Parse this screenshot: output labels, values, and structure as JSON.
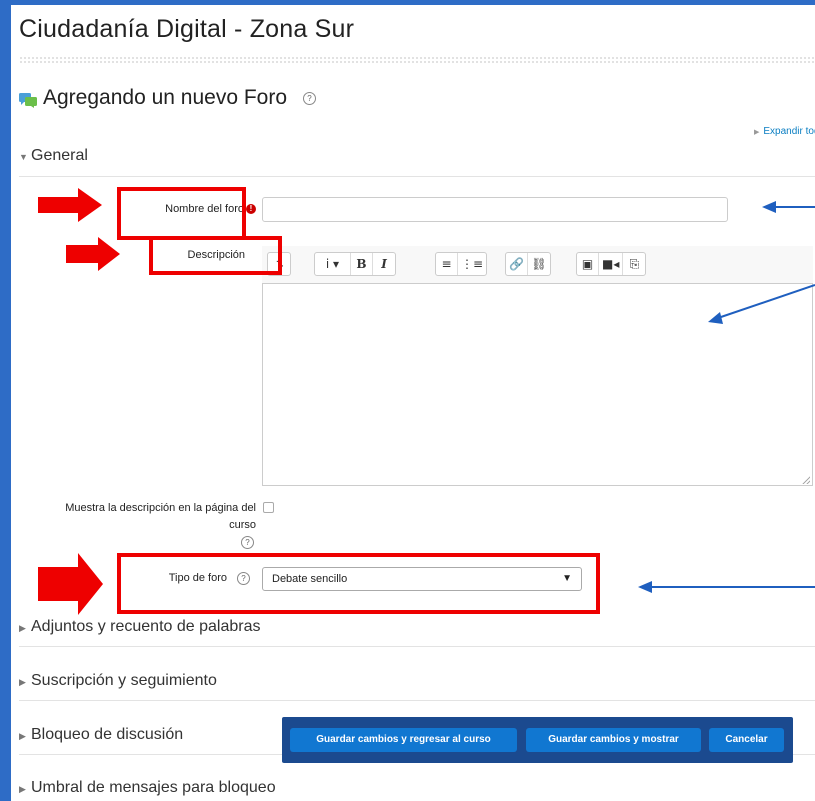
{
  "site_title": "Ciudadanía Digital - Zona Sur",
  "page_heading": "Agregando un nuevo Foro",
  "expand_all": "Expandir todo",
  "sections": {
    "general": "General",
    "adjuntos": "Adjuntos y recuento de palabras",
    "suscripcion": "Suscripción y seguimiento",
    "bloqueo": "Bloqueo de discusión",
    "umbral": "Umbral de mensajes para bloqueo"
  },
  "fields": {
    "forum_name_label": "Nombre del foro",
    "forum_name_value": "",
    "description_label": "Descripción",
    "show_description_label_line1": "Muestra la descripción en la página del",
    "show_description_label_line2": "curso",
    "forum_type_label": "Tipo de foro",
    "forum_type_value": "Debate sencillo"
  },
  "editor_toolbar": {
    "collapse": "↴",
    "info": "i ▾",
    "bold": "B",
    "italic": "I",
    "unordered_list": "≡",
    "ordered_list": "⋮≡",
    "link": "🔗",
    "unlink": "⛓",
    "image": "▣",
    "media": "■◂",
    "manage_files": "⎘"
  },
  "buttons": {
    "save_return": "Guardar cambios y regresar al curso",
    "save_display": "Guardar cambios y mostrar",
    "cancel": "Cancelar"
  },
  "colors": {
    "frame_blue": "#2e6cc6",
    "annotation_red": "#ee0000",
    "arrow_blue": "#1f5fbf",
    "button_blue": "#1177d1",
    "savebar_navy": "#1b4a8f"
  }
}
